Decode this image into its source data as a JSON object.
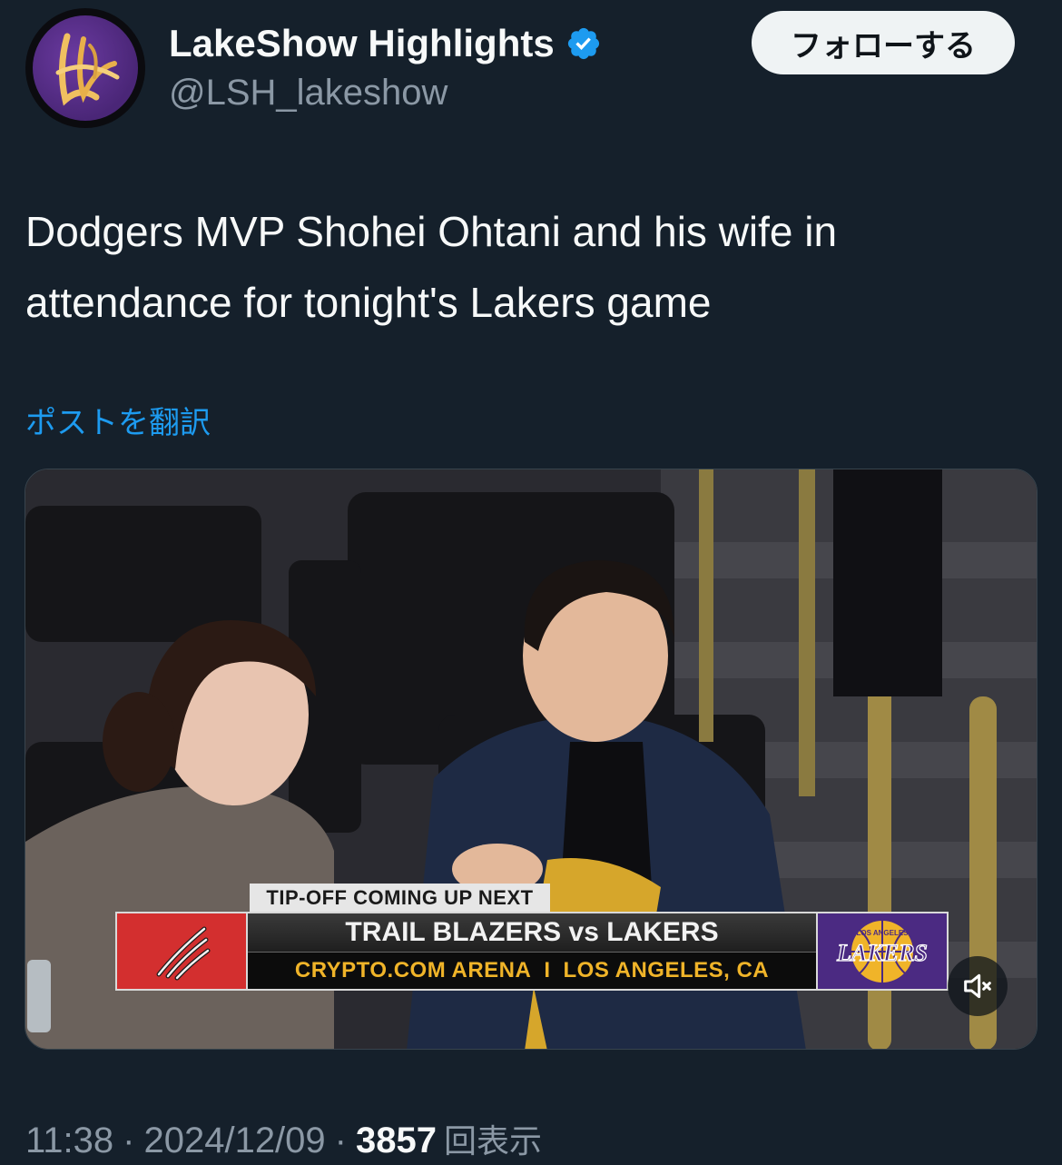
{
  "header": {
    "display_name": "LakeShow Highlights",
    "handle": "@LSH_lakeshow",
    "follow_label": "フォローする",
    "avatar_icon": "lakeshow-logo-icon",
    "verified_icon": "verified-badge-icon",
    "verified_color": "#1d9bf0"
  },
  "tweet": {
    "text": "Dodgers MVP Shohei Ohtani and his wife in attendance for tonight's Lakers game",
    "translate_label": "ポストを翻訳"
  },
  "media": {
    "overlay": {
      "tipoff": "TIP-OFF COMING UP NEXT",
      "matchup": "TRAIL BLAZERS vs LAKERS",
      "arena": "CRYPTO.COM ARENA",
      "divider": "I",
      "location": "LOS ANGELES, CA",
      "lakers_logo_text": "LAKERS",
      "lakers_logo_subtext": "LOS ANGELES"
    },
    "mute_icon": "speaker-muted-icon"
  },
  "meta": {
    "time": "11:38",
    "separator": "·",
    "date": "2024/12/09",
    "views_count": "3857",
    "views_label": "回表示"
  },
  "colors": {
    "background": "#15202b",
    "accent": "#1d9bf0",
    "muted_text": "#8b98a5"
  }
}
